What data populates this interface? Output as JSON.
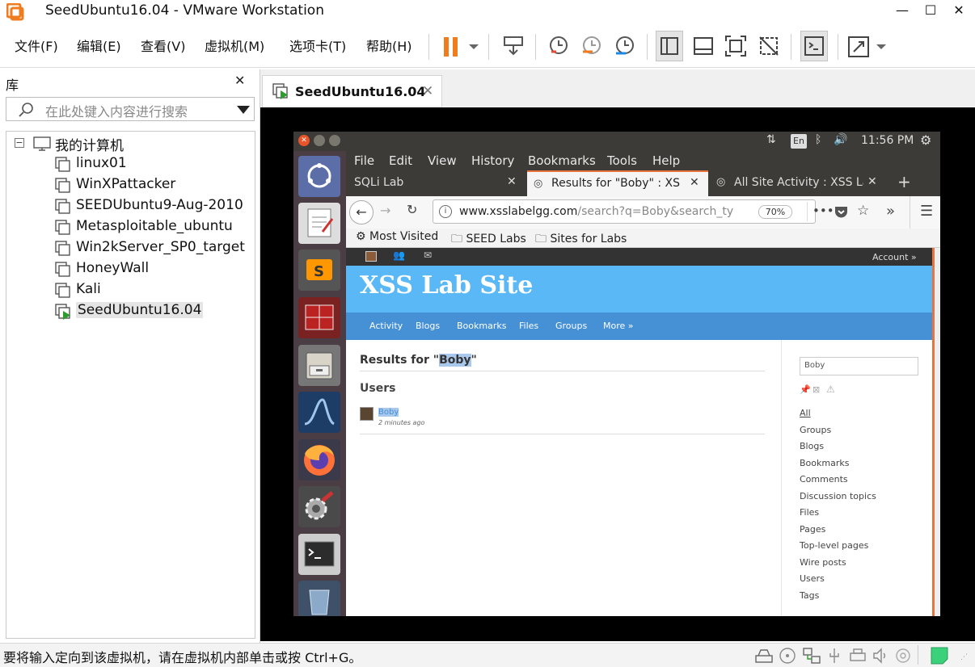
{
  "window": {
    "title": "SeedUbuntu16.04 - VMware Workstation",
    "minimize_icon": "minimize-icon",
    "maximize_icon": "maximize-icon",
    "close_icon": "close-icon"
  },
  "menubar": {
    "items": [
      "文件(F)",
      "编辑(E)",
      "查看(V)",
      "虚拟机(M)",
      "选项卡(T)",
      "帮助(H)"
    ]
  },
  "library": {
    "title": "库",
    "search_placeholder": "在此处键入内容进行搜索",
    "root": "我的计算机",
    "vms": [
      "linux01",
      "WinXPattacker",
      "SEEDUbuntu9-Aug-2010",
      "Metasploitable_ubuntu",
      "Win2kServer_SP0_target",
      "HoneyWall",
      "Kali",
      "SeedUbuntu16.04"
    ],
    "selected_vm": "SeedUbuntu16.04"
  },
  "vm_tab": {
    "label": "SeedUbuntu16.04"
  },
  "status_bar": {
    "text": "要将输入定向到该虚拟机，请在虚拟机内部单击或按 Ctrl+G。"
  },
  "guest": {
    "topbar": {
      "keyboard": "En",
      "time": "11:56 PM"
    },
    "firefox": {
      "menu": [
        "File",
        "Edit",
        "View",
        "History",
        "Bookmarks",
        "Tools",
        "Help"
      ],
      "tabs": [
        {
          "label": "SQLi Lab",
          "active": false
        },
        {
          "label": "Results for \"Boby\" : XSS L",
          "active": true
        },
        {
          "label": "All Site Activity : XSS Lab",
          "active": false
        }
      ],
      "url_host": "www.xsslabelgg.com",
      "url_path": "/search?q=Boby&search_ty",
      "zoom": "70%",
      "bookmarks": [
        "Most Visited",
        "SEED Labs",
        "Sites for Labs"
      ]
    },
    "page": {
      "account": "Account »",
      "site_title": "XSS Lab Site",
      "nav": [
        "Activity",
        "Blogs",
        "Bookmarks",
        "Files",
        "Groups",
        "More »"
      ],
      "results_prefix": "Results for \"",
      "query": "Boby",
      "results_suffix": "\"",
      "users_heading": "Users",
      "user_name": "Boby",
      "user_time": "2 minutes ago",
      "search_value": "Boby",
      "sidebar_links": [
        "All",
        "Groups",
        "Blogs",
        "Bookmarks",
        "Comments",
        "Discussion topics",
        "Files",
        "Pages",
        "Top-level pages",
        "Wire posts",
        "Users",
        "Tags"
      ]
    }
  },
  "colors": {
    "vmware_orange": "#f07c20",
    "pause_orange": "#f07c20",
    "elgg_header": "#59b8f5",
    "elgg_nav": "#4690d6",
    "ubuntu_launcher": "#4a3d44",
    "firefox_chrome": "#3c3b37"
  }
}
